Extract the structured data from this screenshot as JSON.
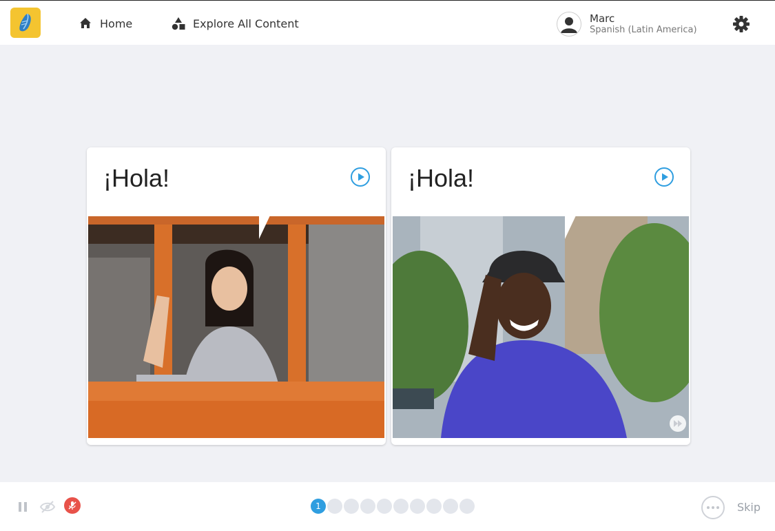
{
  "app": {
    "brand_color": "#f4c430",
    "accent_color": "#2f9ee0"
  },
  "nav": {
    "home_label": "Home",
    "explore_label": "Explore All Content"
  },
  "user": {
    "name": "Marc",
    "language": "Spanish (Latin America)"
  },
  "cards": [
    {
      "text": "¡Hola!",
      "icon": "play-circle-icon"
    },
    {
      "text": "¡Hola!",
      "icon": "play-circle-icon"
    }
  ],
  "progress": {
    "current": "1",
    "total_dots": 10
  },
  "footer": {
    "skip_label": "Skip",
    "mic_color": "#e8524a"
  }
}
